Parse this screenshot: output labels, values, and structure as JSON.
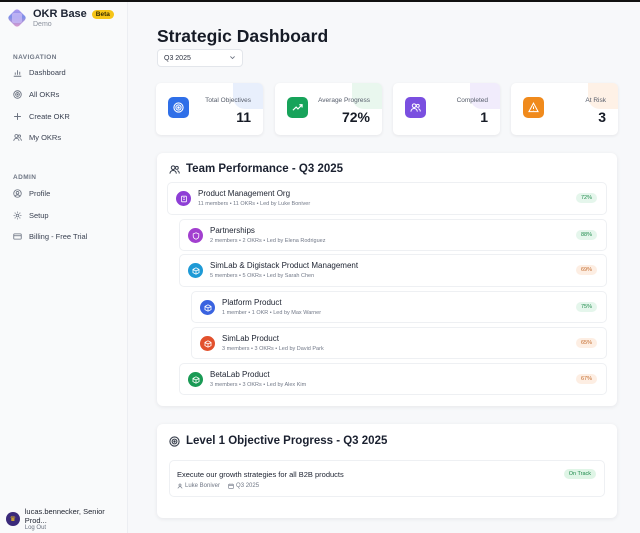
{
  "sidebar": {
    "brand": {
      "name": "OKR Base",
      "badge": "Beta",
      "subtitle": "Demo"
    },
    "navigation_label": "NAVIGATION",
    "nav": [
      {
        "label": "Dashboard",
        "icon": "bar-chart-icon"
      },
      {
        "label": "All OKRs",
        "icon": "target-icon"
      },
      {
        "label": "Create OKR",
        "icon": "plus-icon"
      },
      {
        "label": "My OKRs",
        "icon": "users-icon"
      }
    ],
    "admin_label": "ADMIN",
    "admin": [
      {
        "label": "Profile",
        "icon": "user-icon"
      },
      {
        "label": "Setup",
        "icon": "gear-icon"
      },
      {
        "label": "Billing - Free Trial",
        "icon": "card-icon"
      }
    ],
    "user": {
      "name": "lucas.bennecker, Senior Prod...",
      "logout": "Log Out"
    }
  },
  "main": {
    "title": "Strategic Dashboard",
    "quarter": {
      "selected": "Q3 2025"
    },
    "stats": [
      {
        "label": "Total Objectives",
        "value": "11",
        "color": "#2f6fe8",
        "icon": "target-icon"
      },
      {
        "label": "Average Progress",
        "value": "72%",
        "color": "#17a35a",
        "icon": "trending-up-icon"
      },
      {
        "label": "Completed",
        "value": "1",
        "color": "#7a4fe0",
        "icon": "users-icon"
      },
      {
        "label": "At Risk",
        "value": "3",
        "color": "#f08a1c",
        "icon": "warning-icon"
      }
    ],
    "team_performance": {
      "title": "Team Performance - Q3 2025",
      "orgs": [
        {
          "name": "Product Management Org",
          "members": "11 members",
          "okrs": "11 OKRs",
          "lead": "Led by Luke Boniver",
          "pct": "72%",
          "status": "green",
          "color": "#8e3fd6"
        },
        {
          "name": "Partnerships",
          "members": "2 members",
          "okrs": "2 OKRs",
          "lead": "Led by Elena Rodriguez",
          "pct": "88%",
          "status": "green",
          "color": "#a23fcf"
        },
        {
          "name": "SimLab & Digistack Product Management",
          "members": "5 members",
          "okrs": "5 OKRs",
          "lead": "Led by Sarah Chen",
          "pct": "69%",
          "status": "orange",
          "color": "#1e9ad6"
        },
        {
          "name": "Platform Product",
          "members": "1 member",
          "okrs": "1 OKR",
          "lead": "Led by Max Warner",
          "pct": "75%",
          "status": "green",
          "color": "#3a63e0"
        },
        {
          "name": "SimLab Product",
          "members": "3 members",
          "okrs": "3 OKRs",
          "lead": "Led by David Park",
          "pct": "65%",
          "status": "orange",
          "color": "#e2512d"
        },
        {
          "name": "BetaLab Product",
          "members": "3 members",
          "okrs": "3 OKRs",
          "lead": "Led by Alex Kim",
          "pct": "67%",
          "status": "orange",
          "color": "#1a9a55"
        }
      ]
    },
    "objective_progress": {
      "title": "Level 1 Objective Progress - Q3 2025",
      "objective": {
        "title": "Execute our growth strategies for all B2B products",
        "owner": "Luke Boniver",
        "quarter": "Q3 2025",
        "status": "On Track"
      }
    }
  }
}
